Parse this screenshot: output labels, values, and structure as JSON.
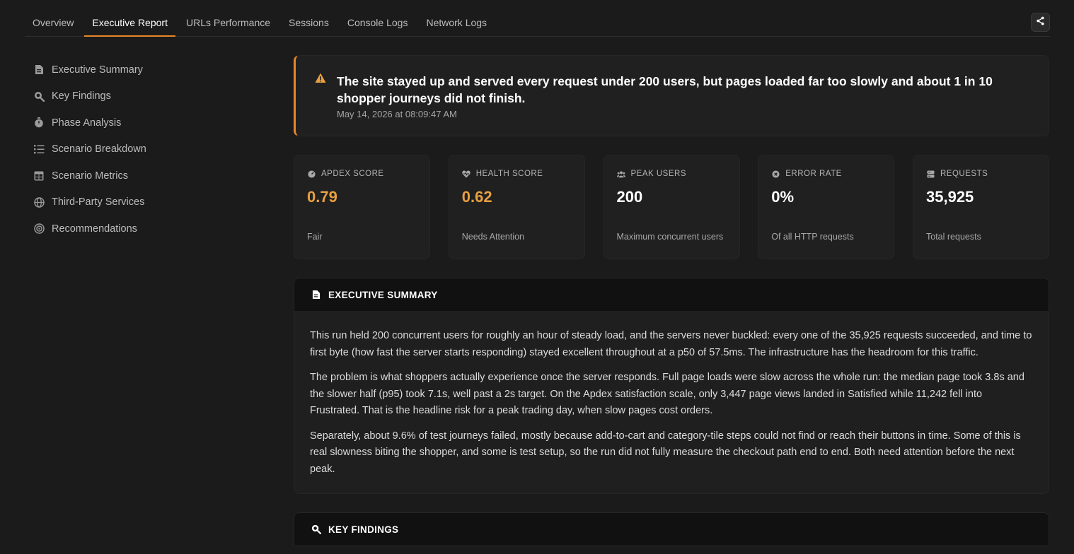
{
  "tabs": [
    {
      "label": "Overview"
    },
    {
      "label": "Executive Report"
    },
    {
      "label": "URLs Performance"
    },
    {
      "label": "Sessions"
    },
    {
      "label": "Console Logs"
    },
    {
      "label": "Network Logs"
    }
  ],
  "active_tab": "Executive Report",
  "sidebar": {
    "items": [
      {
        "label": "Executive Summary",
        "icon": "document-icon"
      },
      {
        "label": "Key Findings",
        "icon": "search-zoom-icon"
      },
      {
        "label": "Phase Analysis",
        "icon": "stopwatch-icon"
      },
      {
        "label": "Scenario Breakdown",
        "icon": "checklist-icon"
      },
      {
        "label": "Scenario Metrics",
        "icon": "table-icon"
      },
      {
        "label": "Third-Party Services",
        "icon": "globe-icon"
      },
      {
        "label": "Recommendations",
        "icon": "target-icon"
      }
    ]
  },
  "alert": {
    "title": "The site stayed up and served every request under 200 users, but pages loaded far too slowly and about 1 in 10 shopper journeys did not finish.",
    "date": "May 14, 2026 at 08:09:47 AM"
  },
  "cards": [
    {
      "label": "APDEX SCORE",
      "value": "0.79",
      "sub": "Fair",
      "icon": "gauge-icon"
    },
    {
      "label": "HEALTH SCORE",
      "value": "0.62",
      "sub": "Needs Attention",
      "icon": "heart-pulse-icon"
    },
    {
      "label": "PEAK USERS",
      "value": "200",
      "sub": "Maximum concurrent users",
      "icon": "users-icon"
    },
    {
      "label": "ERROR RATE",
      "value": "0%",
      "sub": "Of all HTTP requests",
      "icon": "error-circle-icon"
    },
    {
      "label": "REQUESTS",
      "value": "35,925",
      "sub": "Total requests",
      "icon": "server-icon"
    }
  ],
  "summary": {
    "heading": "EXECUTIVE SUMMARY",
    "paragraphs": [
      "This run held 200 concurrent users for roughly an hour of steady load, and the servers never buckled: every one of the 35,925 requests succeeded, and time to first byte (how fast the server starts responding) stayed excellent throughout at a p50 of 57.5ms. The infrastructure has the headroom for this traffic.",
      "The problem is what shoppers actually experience once the server responds. Full page loads were slow across the whole run: the median page took 3.8s and the slower half (p95) took 7.1s, well past a 2s target. On the Apdex satisfaction scale, only 3,447 page views landed in Satisfied while 11,242 fell into Frustrated. That is the headline risk for a peak trading day, when slow pages cost orders.",
      "Separately, about 9.6% of test journeys failed, mostly because add-to-cart and category-tile steps could not find or reach their buttons in time. Some of this is real slowness biting the shopper, and some is test setup, so the run did not fully measure the checkout path end to end. Both need attention before the next peak."
    ]
  },
  "findings": {
    "heading": "KEY FINDINGS"
  },
  "colors": {
    "accent": "#e8862a",
    "warning_value": "#e8a040",
    "background": "#1b1b1b"
  }
}
